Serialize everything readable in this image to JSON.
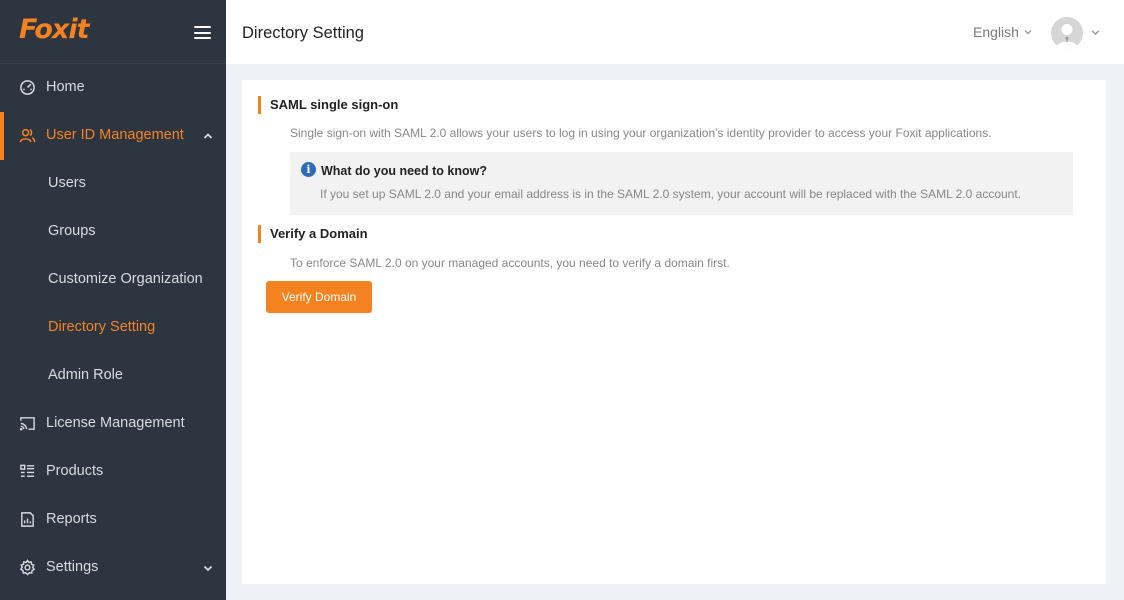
{
  "brand": {
    "logo_text": "Foxit",
    "accent": "#f58220",
    "sidebar_bg": "#2d3540"
  },
  "sidebar": {
    "items": [
      {
        "label": "Home",
        "icon": "dashboard-icon"
      },
      {
        "label": "User ID Management",
        "icon": "users-icon",
        "active": true,
        "expanded": true,
        "children": [
          {
            "label": "Users"
          },
          {
            "label": "Groups"
          },
          {
            "label": "Customize Organization"
          },
          {
            "label": "Directory Setting",
            "selected": true
          },
          {
            "label": "Admin Role"
          }
        ]
      },
      {
        "label": "License Management",
        "icon": "cast-icon"
      },
      {
        "label": "Products",
        "icon": "list-icon"
      },
      {
        "label": "Reports",
        "icon": "report-icon"
      },
      {
        "label": "Settings",
        "icon": "gear-icon",
        "expanded": false
      }
    ]
  },
  "header": {
    "title": "Directory Setting",
    "language": "English"
  },
  "main": {
    "saml": {
      "title": "SAML single sign-on",
      "description": "Single sign-on with SAML 2.0 allows your users to log in using your organization's identity provider to access your Foxit applications.",
      "info_title": "What do you need to know?",
      "info_text": "If you set up SAML 2.0 and your email address is in the SAML 2.0 system, your account will be replaced with the SAML 2.0 account."
    },
    "verify": {
      "title": "Verify a Domain",
      "description": "To enforce SAML 2.0 on your managed accounts, you need to verify a domain first.",
      "button_label": "Verify Domain"
    }
  }
}
